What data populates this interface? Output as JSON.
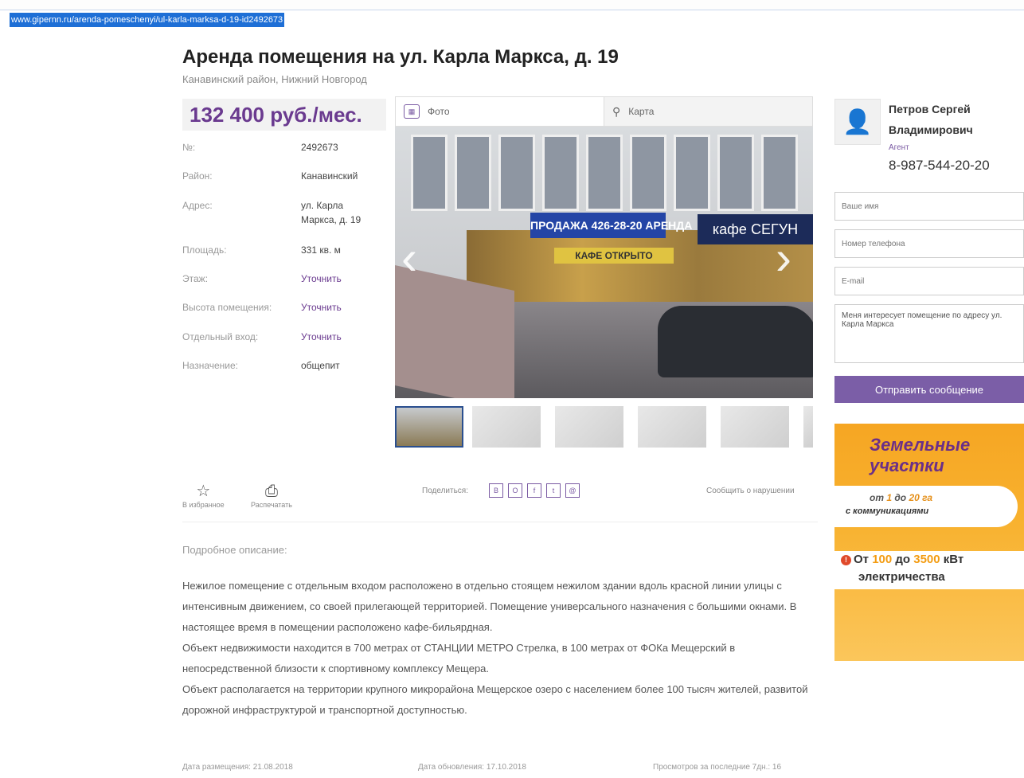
{
  "browser": {
    "url": "www.gipernn.ru/arenda-pomeschenyi/ul-karla-marksa-d-19-id2492673"
  },
  "listing": {
    "title": "Аренда помещения на ул. Карла Маркса, д. 19",
    "subtitle": "Канавинский район, Нижний Новгород",
    "price": "132 400 руб./мес.",
    "properties": [
      {
        "label": "№:",
        "value": "2492673"
      },
      {
        "label": "Район:",
        "value": "Канавинский"
      },
      {
        "label": "Адрес:",
        "value": "ул. Карла Маркса, д. 19"
      },
      {
        "label": "Площадь:",
        "value": "331 кв. м"
      },
      {
        "label": "Этаж:",
        "value": "Уточнить"
      },
      {
        "label": "Высота помещения:",
        "value": "Уточнить"
      },
      {
        "label": "Отдельный вход:",
        "value": "Уточнить"
      },
      {
        "label": "Назначение:",
        "value": "общепит"
      }
    ]
  },
  "media": {
    "tab_photo": "Фото",
    "tab_map": "Карта",
    "signs": {
      "sale_rent": "ПРОДАЖА 426-28-20 АРЕНДА",
      "cafe": "кафе СЕГУН",
      "open": "КАФЕ ОТКРЫТО"
    }
  },
  "actions": {
    "favorite": "В избранное",
    "print": "Распечатать",
    "share_label": "Поделиться:",
    "share_icons": [
      "vk-icon",
      "ok-icon",
      "fb-icon",
      "tw-icon",
      "mail-icon"
    ],
    "report": "Сообщить о нарушении"
  },
  "description": {
    "heading": "Подробное описание:",
    "paragraphs": [
      "Нежилое помещение с отдельным входом расположено в отдельно стоящем нежилом здании вдоль красной линии улицы с интенсивным движением, со своей прилегающей территорией. Помещение универсального назначения с большими окнами. В настоящее время в помещении расположено кафе-бильярдная.",
      "Объект недвижимости находится в 700 метрах от СТАНЦИИ МЕТРО Стрелка, в 100 метрах от ФОКа Мещерский в непосредственной близости к спортивному комплексу Мещера.",
      "Объект располагается на территории крупного микрорайона Мещерское озеро с населением более 100 тысяч жителей, развитой дорожной инфраструктурой и транспортной доступностью."
    ]
  },
  "footer": {
    "placed": "Дата размещения: 21.08.2018",
    "updated": "Дата обновления: 17.10.2018",
    "views": "Просмотров за последние 7дн.: 16"
  },
  "agent": {
    "name": "Петров Сергей Владимирович",
    "role": "Агент",
    "phone": "8-987-544-20-20"
  },
  "form": {
    "name_placeholder": "Ваше имя",
    "phone_placeholder": "Номер телефона",
    "email_placeholder": "E-mail",
    "message_value": "Меня интересует помещение по адресу ул. Карла Маркса",
    "submit": "Отправить сообщение"
  },
  "ad": {
    "heading_1": "Земельные",
    "heading_2": "участки",
    "line1_a": "от ",
    "line1_b": "1",
    "line1_c": " до ",
    "line1_d": "20 га",
    "line2": "с коммуникациями",
    "kw_a": "От ",
    "kw_b": "100",
    "kw_c": " до ",
    "kw_d": "3500",
    "kw_e": " кВт",
    "kw_line2": "электричества"
  }
}
